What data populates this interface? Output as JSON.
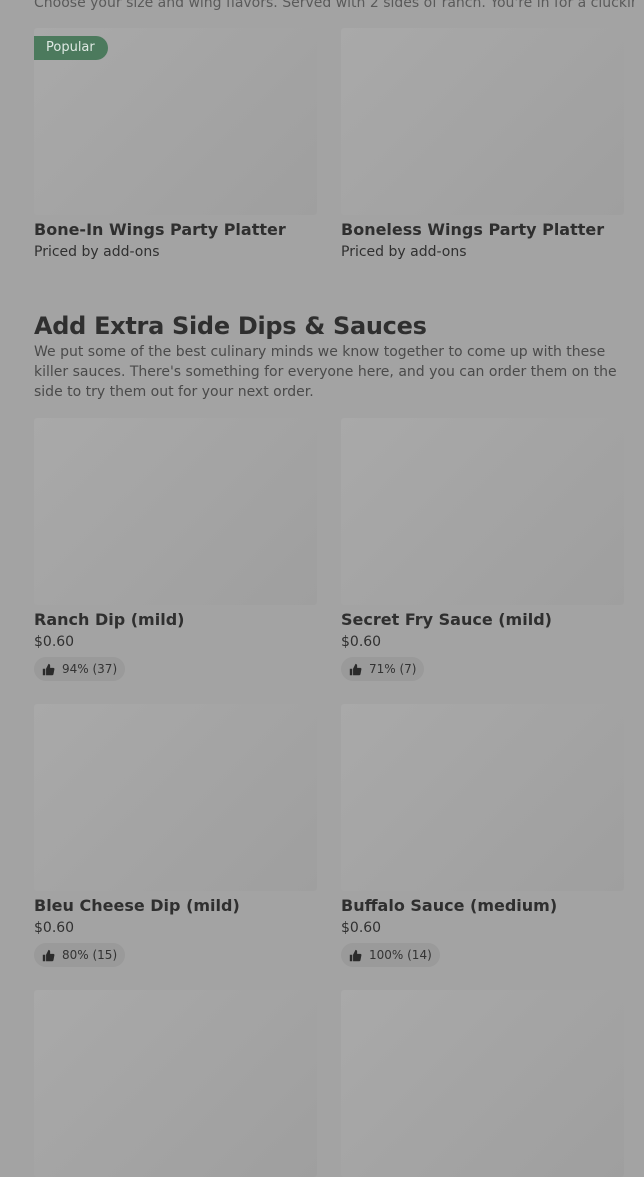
{
  "top_section": {
    "description": "Choose your size and wing flavors. Served with 2 sides of ranch. You're in for a cluckin' treat!",
    "items": [
      {
        "badge": "Popular",
        "title": "Bone-In Wings Party Platter",
        "subtitle": "Priced by add-ons"
      },
      {
        "title": "Boneless Wings Party Platter",
        "subtitle": "Priced by add-ons"
      }
    ]
  },
  "sauces_section": {
    "title": "Add Extra Side Dips & Sauces",
    "description": "We put some of the best culinary minds we know together to come up with these killer sauces. There's something for everyone here, and you can order them on the side to try them out for your next order.",
    "items": [
      {
        "title": "Ranch Dip (mild)",
        "price": "$0.60",
        "rating": "94% (37)"
      },
      {
        "title": "Secret Fry Sauce (mild)",
        "price": "$0.60",
        "rating": "71% (7)"
      },
      {
        "title": "Bleu Cheese Dip (mild)",
        "price": "$0.60",
        "rating": "80% (15)"
      },
      {
        "title": "Buffalo Sauce (medium)",
        "price": "$0.60",
        "rating": "100% (14)"
      }
    ]
  },
  "icons": {
    "rating": "thumbs-up-icon"
  },
  "colors": {
    "badge_bg": "#4c7a5d",
    "overlay_bg": "#a3a3a3"
  }
}
